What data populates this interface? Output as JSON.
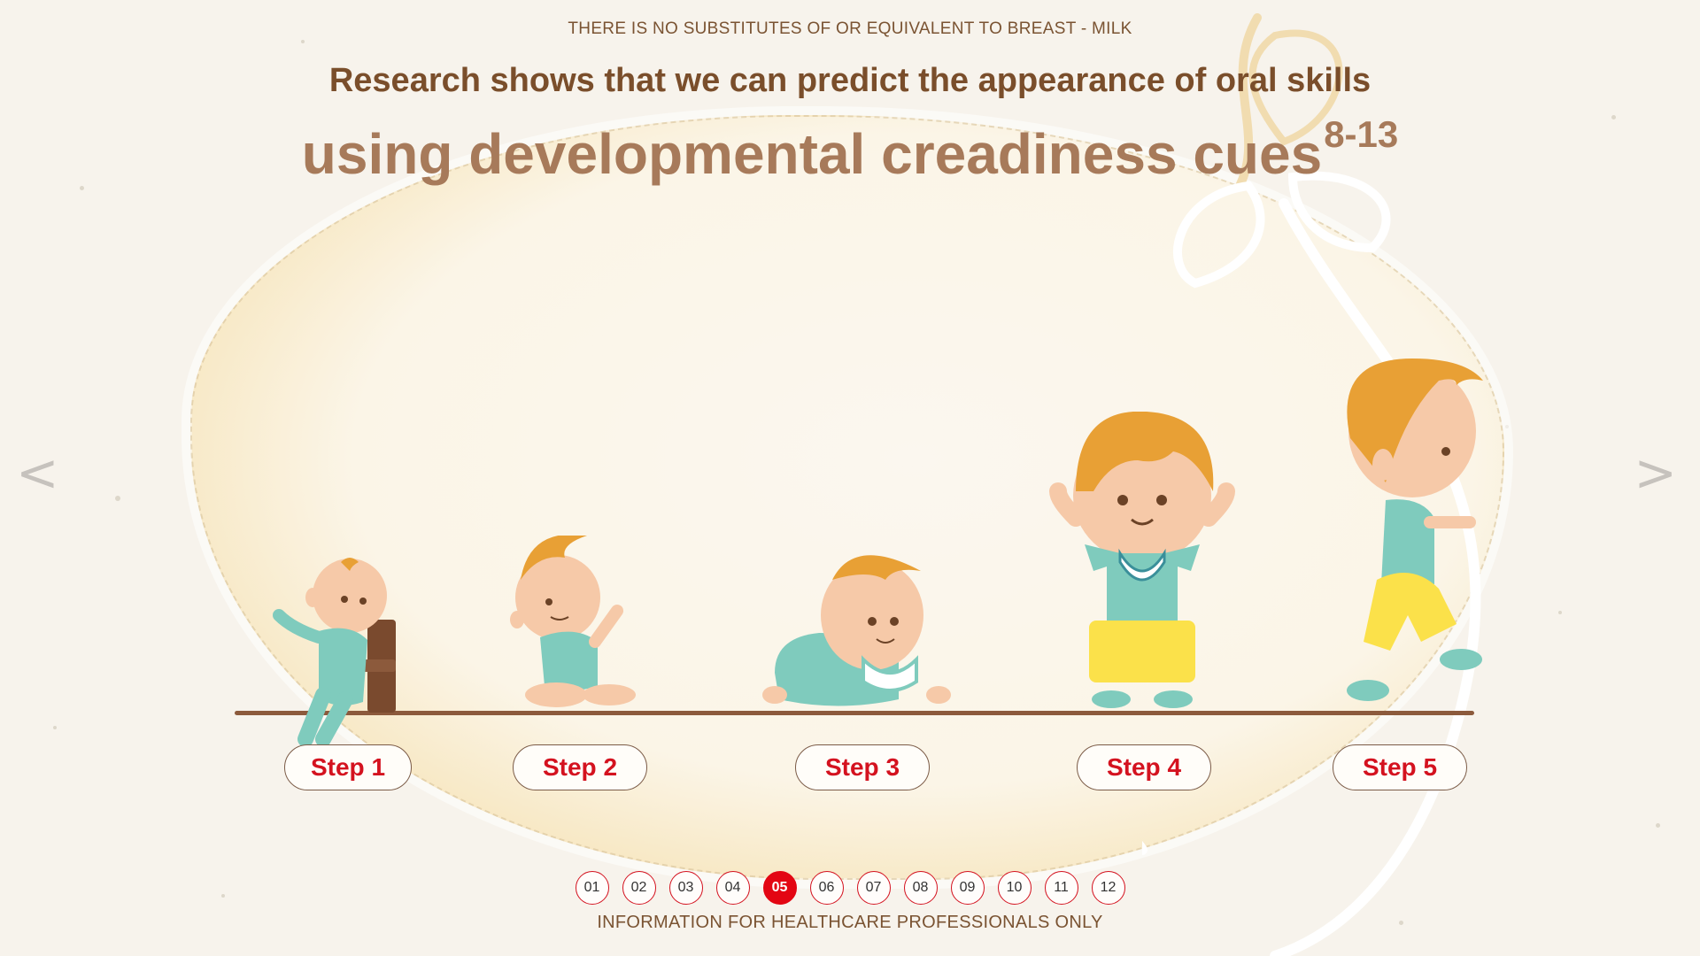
{
  "header": {
    "top_note": "THERE IS NO SUBSTITUTES OF OR EQUIVALENT TO BREAST - MILK",
    "headline_line1": "Research shows that we can predict the appearance of oral skills",
    "headline_line2": "using developmental creadiness cues",
    "headline_superscript": "8-13"
  },
  "navigation": {
    "prev_arrow": "<",
    "next_arrow": ">"
  },
  "steps": [
    {
      "label": "Step 1"
    },
    {
      "label": "Step 2"
    },
    {
      "label": "Step 3"
    },
    {
      "label": "Step 4"
    },
    {
      "label": "Step 5"
    }
  ],
  "pager": {
    "pages": [
      "01",
      "02",
      "03",
      "04",
      "05",
      "06",
      "07",
      "08",
      "09",
      "10",
      "11",
      "12"
    ],
    "active": "05"
  },
  "footer": {
    "note": "INFORMATION FOR HEALTHCARE PROFESSIONALS ONLY"
  },
  "colors": {
    "accent_red": "#e30613",
    "step_text": "#d4121f",
    "headline_brown": "#7a4e2b",
    "headline_light": "#a77a5a",
    "outfit_teal": "#7fcbbd",
    "pants_yellow": "#fbe14a",
    "hair_orange": "#e8a035",
    "skin": "#f6c9a8"
  }
}
